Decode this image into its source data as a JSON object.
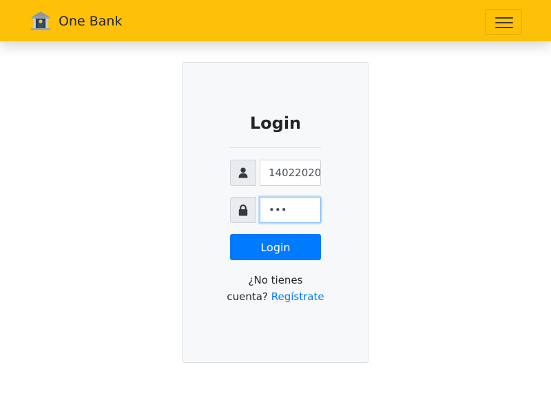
{
  "navbar": {
    "brand_text": "One Bank",
    "logo_icon": "bank-building-icon",
    "menu_icon": "hamburger-menu-icon",
    "background_color": "#ffc107"
  },
  "login": {
    "title": "Login",
    "username": {
      "icon": "user-icon",
      "value": "14022020"
    },
    "password": {
      "icon": "lock-icon",
      "value": "•••"
    },
    "submit_label": "Login",
    "prompt_line1": "¿No tienes",
    "prompt_line2": "cuenta?",
    "register_link": "Regístrate",
    "accent_color": "#007bff"
  }
}
